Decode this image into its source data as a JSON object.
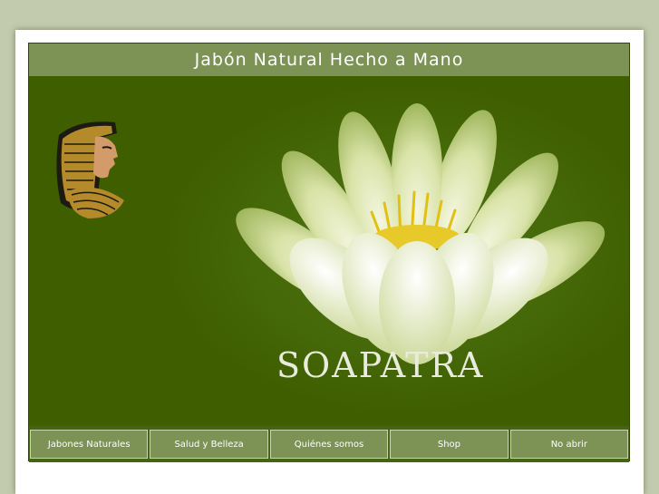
{
  "header": {
    "title": "Jabón Natural Hecho a Mano"
  },
  "hero": {
    "brand_text": "SOAPATRA",
    "logo_icon": "cleopatra-portrait-icon",
    "image_icon": "water-lily-icon"
  },
  "nav": {
    "items": [
      {
        "label": "Jabones Naturales"
      },
      {
        "label": "Salud y Belleza"
      },
      {
        "label": "Quiénes somos"
      },
      {
        "label": "Shop"
      },
      {
        "label": "No abrir"
      }
    ]
  },
  "colors": {
    "background": "#c3cbae",
    "title_bar": "#7d9356",
    "hero": "#3f5e00",
    "nav_button": "#7d9356"
  }
}
